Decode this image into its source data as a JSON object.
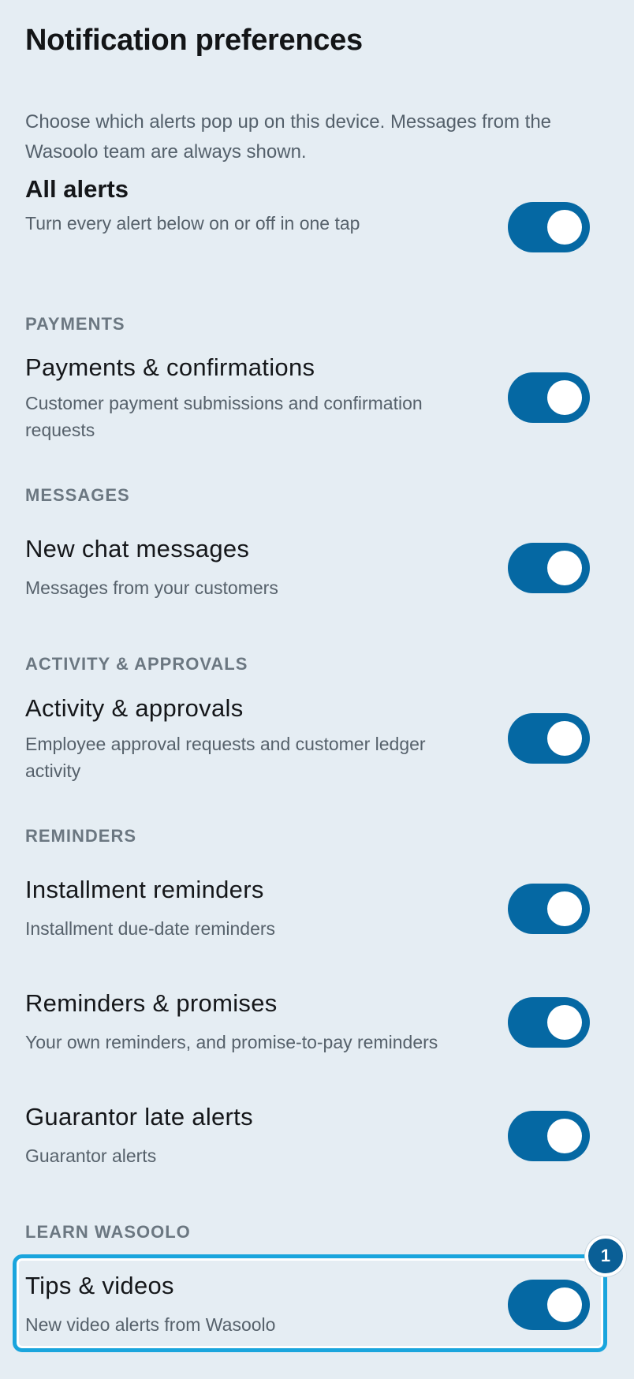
{
  "header": {
    "title": "Notification preferences",
    "intro": "Choose which alerts pop up on this device. Messages from the Wasoolo team are always shown."
  },
  "master": {
    "title": "All alerts",
    "description": "Turn every alert below on or off in one tap",
    "enabled": true
  },
  "sections": {
    "payments": "PAYMENTS",
    "messages": "MESSAGES",
    "activity": "ACTIVITY & APPROVALS",
    "reminders": "REMINDERS",
    "learn": "LEARN WASOOLO"
  },
  "items": {
    "payments_confirmations": {
      "title": "Payments & confirmations",
      "description": "Customer payment submissions and confirmation requests",
      "enabled": true
    },
    "chat_messages": {
      "title": "New chat messages",
      "description": "Messages from your customers",
      "enabled": true
    },
    "activity_approvals": {
      "title": "Activity & approvals",
      "description": "Employee approval requests and customer ledger activity",
      "enabled": true
    },
    "installment_reminders": {
      "title": "Installment reminders",
      "description": "Installment due-date reminders",
      "enabled": true
    },
    "reminders_promises": {
      "title": "Reminders & promises",
      "description": "Your own reminders, and promise-to-pay reminders",
      "enabled": true
    },
    "guarantor_alerts": {
      "title": "Guarantor late alerts",
      "description": "Guarantor alerts",
      "enabled": true
    },
    "tips_videos": {
      "title": "Tips & videos",
      "description": "New video alerts from Wasoolo",
      "enabled": true
    }
  },
  "annotation": {
    "badge": "1"
  },
  "colors": {
    "background": "#e5edf3",
    "toggle_on": "#0568a3",
    "highlight": "#1aa5dd",
    "section_header": "#6b7781"
  }
}
